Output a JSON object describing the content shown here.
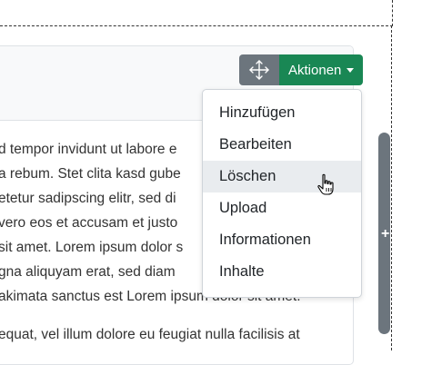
{
  "toolbar": {
    "move_icon": "move-arrows-icon",
    "actions_label": "Aktionen"
  },
  "dropdown": {
    "items": [
      {
        "label": "Hinzufügen"
      },
      {
        "label": "Bearbeiten"
      },
      {
        "label": "Löschen",
        "hovered": true
      },
      {
        "label": "Upload"
      },
      {
        "label": "Informationen"
      },
      {
        "label": "Inhalte"
      }
    ]
  },
  "content": {
    "lines": [
      "d tempor invidunt ut labore e",
      "a rebum. Stet clita kasd gube",
      "etetur sadipscing elitr, sed di",
      "vero eos et accusam et justo",
      "sit amet. Lorem ipsum dolor s",
      "gna aliquyam erat, sed diam",
      "akimata sanctus est Lorem ipsum dolor sit amet."
    ],
    "para2": "equat, vel illum dolore eu feugiat nulla facilisis at"
  },
  "colors": {
    "actions_bg": "#198754",
    "move_bg": "#6c757d",
    "hover_bg": "#e9ecef"
  }
}
